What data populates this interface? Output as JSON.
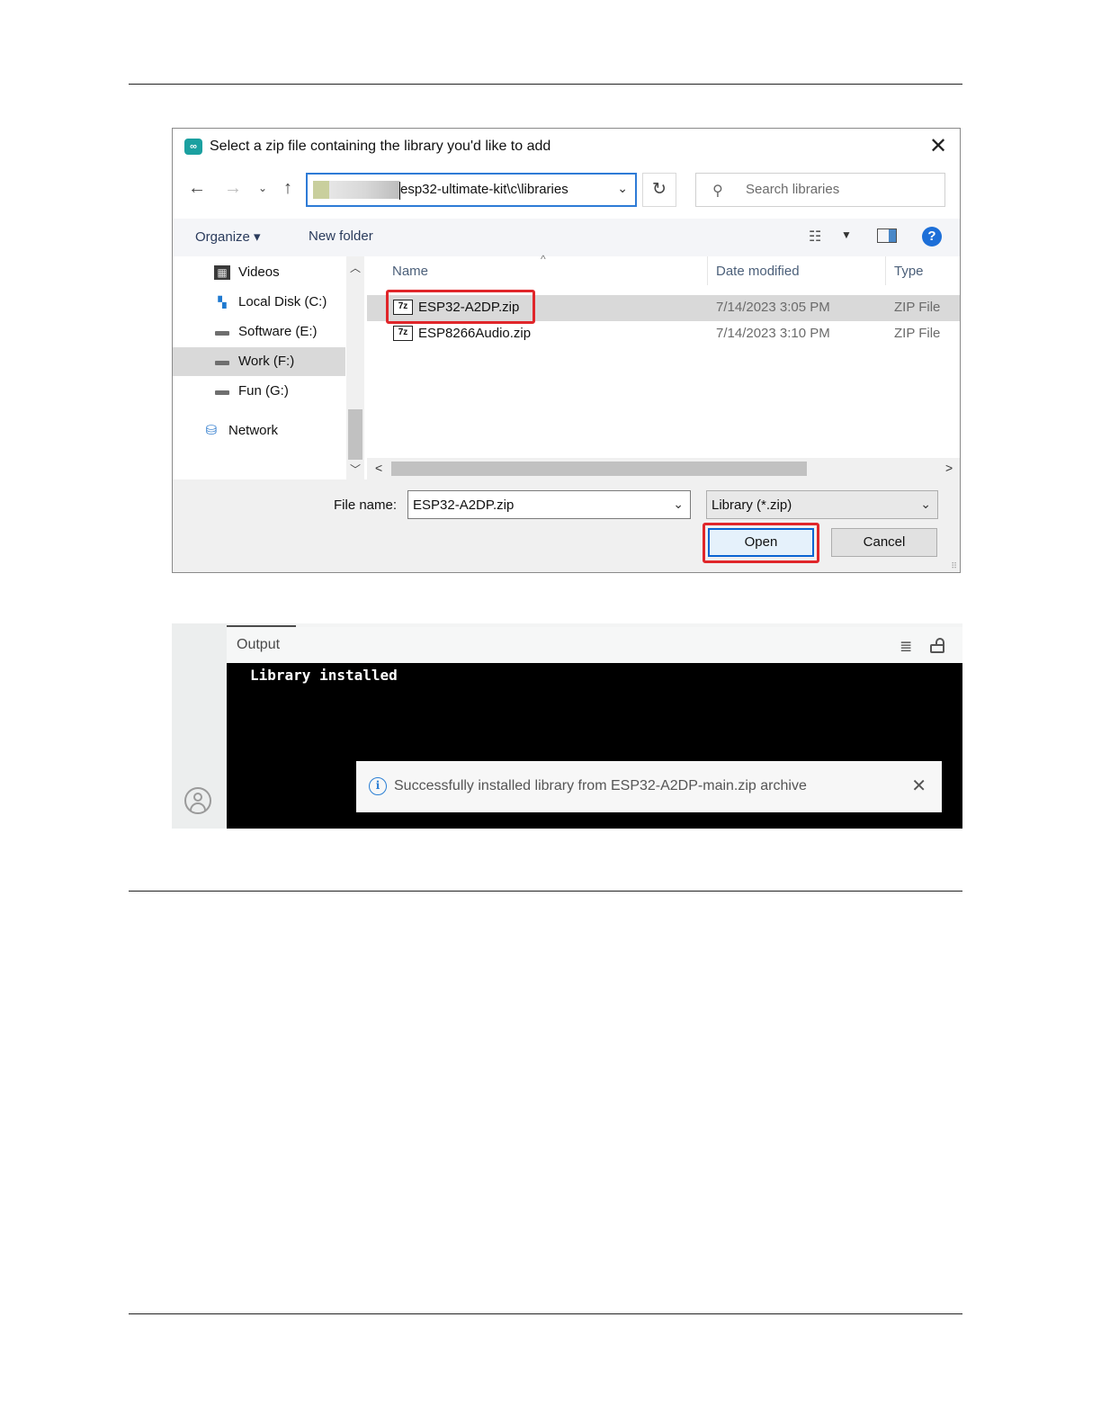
{
  "dialog": {
    "title": "Select a zip file containing the library you'd like to add",
    "app_icon": "∞",
    "address": {
      "path": "esp32-ultimate-kit\\c\\libraries"
    },
    "search": {
      "placeholder": "Search libraries"
    },
    "toolbar": {
      "organize": "Organize ▾",
      "new_folder": "New folder"
    },
    "sidebar": {
      "items": [
        {
          "label": "Videos",
          "icon": "videos-folder-icon"
        },
        {
          "label": "Local Disk (C:)",
          "icon": "local-disk-icon"
        },
        {
          "label": "Software (E:)",
          "icon": "drive-icon"
        },
        {
          "label": "Work (F:)",
          "icon": "drive-icon",
          "selected": true
        },
        {
          "label": "Fun (G:)",
          "icon": "drive-icon"
        },
        {
          "label": "Network",
          "icon": "network-icon"
        }
      ]
    },
    "columns": {
      "name": "Name",
      "date_modified": "Date modified",
      "type": "Type"
    },
    "files": [
      {
        "name": "ESP32-A2DP.zip",
        "date": "7/14/2023 3:05 PM",
        "type": "ZIP File",
        "icon_label": "7z",
        "selected": true
      },
      {
        "name": "ESP8266Audio.zip",
        "date": "7/14/2023 3:10 PM",
        "type": "ZIP File",
        "icon_label": "7z"
      }
    ],
    "footer": {
      "file_name_label": "File name:",
      "file_name_value": "ESP32-A2DP.zip",
      "filter_value": "Library (*.zip)",
      "open_label": "Open",
      "cancel_label": "Cancel"
    }
  },
  "output_panel": {
    "title": "Output",
    "console_text": "Library installed",
    "toast": {
      "icon": "i",
      "message": "Successfully installed library from ESP32-A2DP-main.zip archive"
    }
  },
  "colors": {
    "highlight": "#e0262a",
    "accent_blue": "#2e7bd6",
    "console_bg": "#000000"
  }
}
